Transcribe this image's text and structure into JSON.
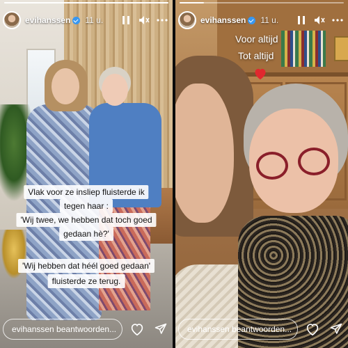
{
  "stories": [
    {
      "username": "evihanssen",
      "time": "11 u.",
      "progress": 1.0,
      "captions": [
        "Vlak voor ze insliep fluisterde ik",
        "tegen haar :",
        "'Wij twee, we hebben dat toch goed",
        "gedaan hè?'",
        "'Wij hebben dat héél goed gedaan'",
        "fluisterde ze terug."
      ],
      "reply_placeholder": "evihanssen beantwoorden..."
    },
    {
      "username": "evihanssen",
      "time": "11 u.",
      "progress": 0.15,
      "overlay_lines": [
        "Voor altijd",
        "Tot altijd"
      ],
      "reply_placeholder": "evihanssen beantwoorden..."
    }
  ],
  "icons": {
    "pause": "pause-icon",
    "mute": "mute-icon",
    "more": "more-icon",
    "like": "heart-icon",
    "share": "send-icon",
    "sticker": "red-heart-sticker"
  },
  "colors": {
    "verified": "#3897f0",
    "heart_sticker": "#e0282e"
  }
}
